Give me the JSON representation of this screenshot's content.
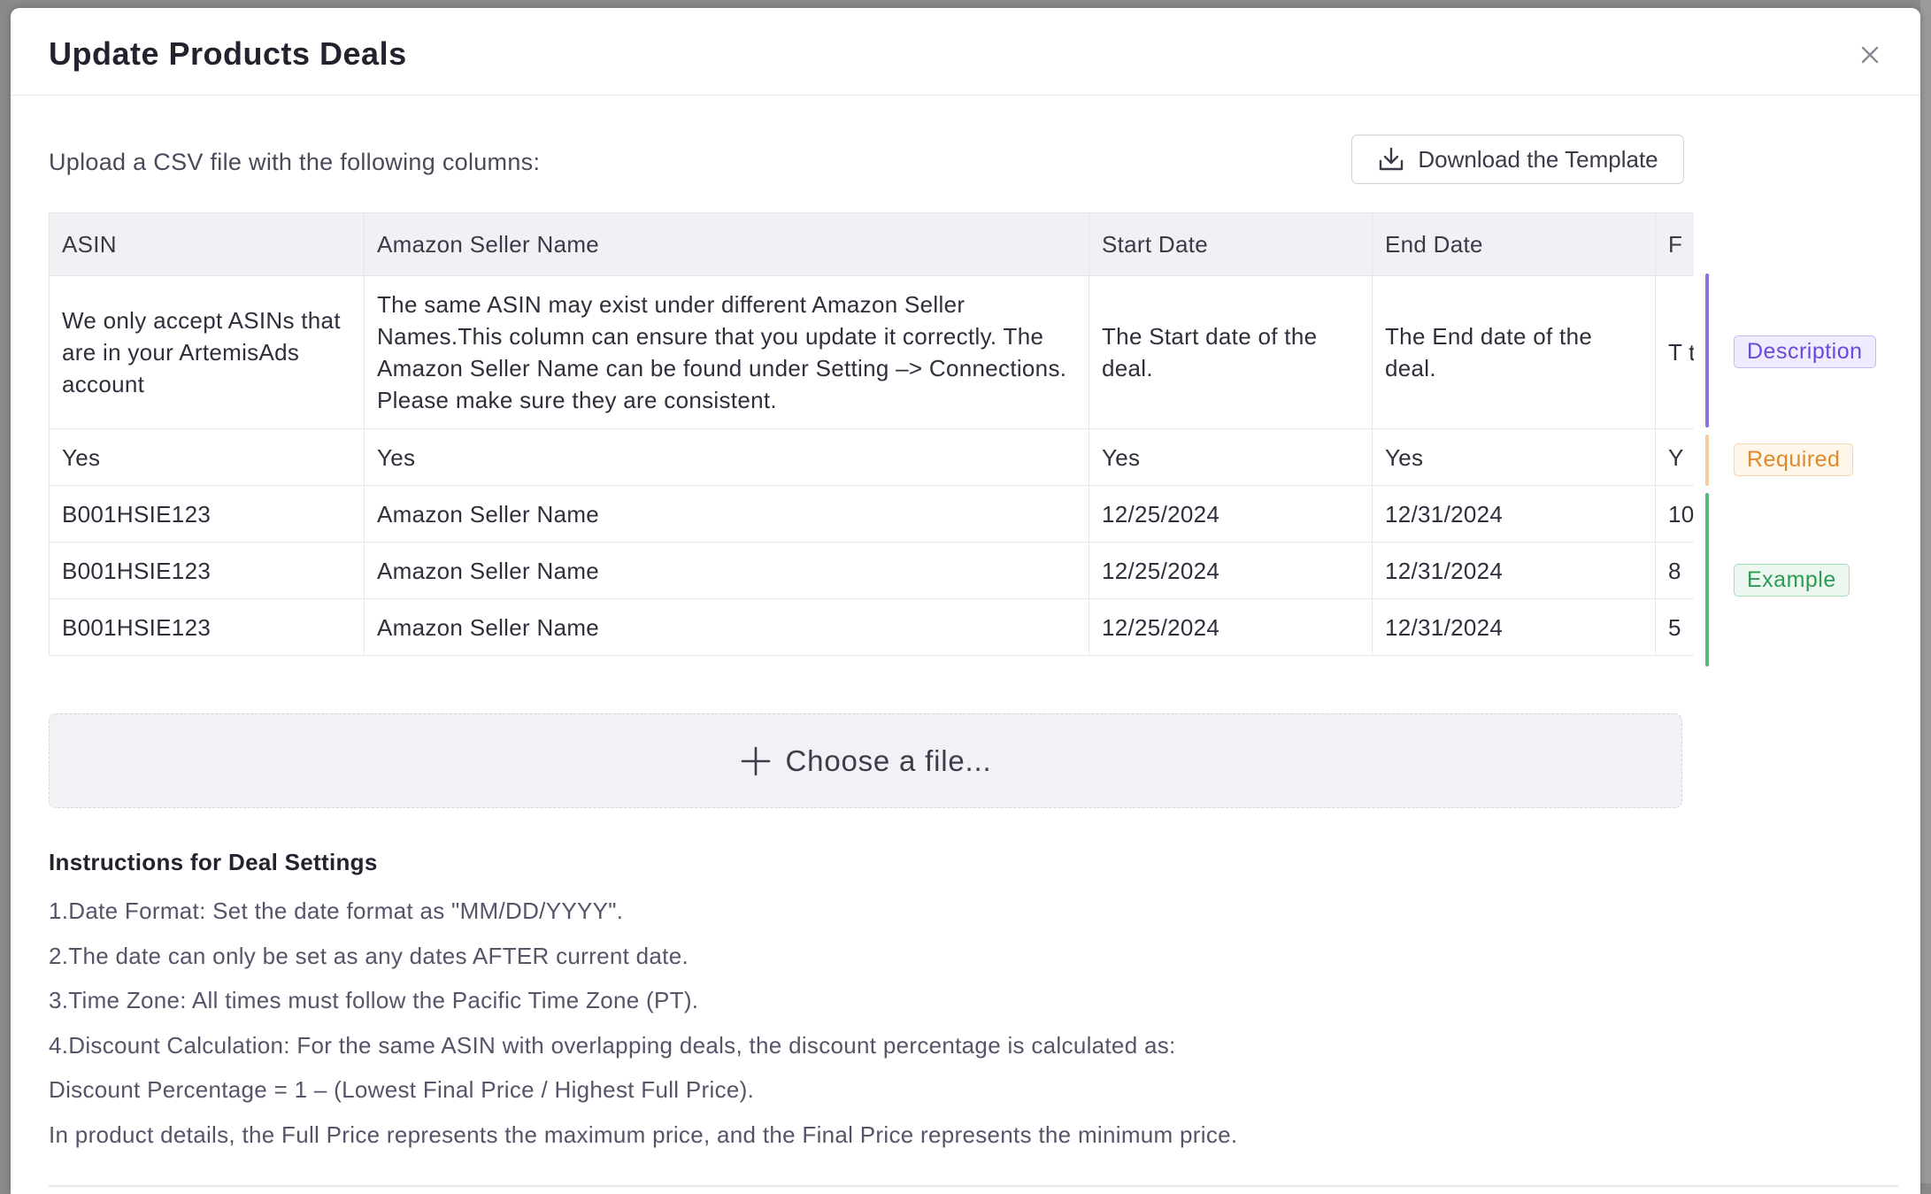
{
  "modal": {
    "title": "Update Products Deals",
    "intro": "Upload a CSV file with the following columns:",
    "download_label": "Download the Template"
  },
  "table": {
    "headers": [
      "ASIN",
      "Amazon Seller Name",
      "Start Date",
      "End Date",
      "F"
    ],
    "description_row": [
      "We only accept ASINs that are in your ArtemisAds account",
      "The same ASIN may exist under different Amazon Seller Names.This column can ensure that you update it correctly. The Amazon Seller Name can be found under Setting –> Connections. Please make sure they are consistent.",
      "The Start date of the deal.",
      "The End date of the deal.",
      "T th d"
    ],
    "required_row": [
      "Yes",
      "Yes",
      "Yes",
      "Yes",
      "Y"
    ],
    "example_rows": [
      [
        "B001HSIE123",
        "Amazon Seller Name",
        "12/25/2024",
        "12/31/2024",
        "10"
      ],
      [
        "B001HSIE123",
        "Amazon Seller Name",
        "12/25/2024",
        "12/31/2024",
        "8"
      ],
      [
        "B001HSIE123",
        "Amazon Seller Name",
        "12/25/2024",
        "12/31/2024",
        "5"
      ]
    ]
  },
  "legend": {
    "description": "Description",
    "required": "Required",
    "example": "Example",
    "colors": {
      "description": "#8f6fe0",
      "required": "#f4cf9a",
      "example": "#5bb47a"
    }
  },
  "upload": {
    "label": "Choose a file..."
  },
  "instructions": {
    "title": "Instructions for Deal Settings",
    "lines": [
      "1.Date Format: Set the date format as \"MM/DD/YYYY\".",
      "2.The date can only be set as any dates AFTER current date.",
      "3.Time Zone: All times must follow the Pacific Time Zone (PT).",
      "4.Discount Calculation: For the same ASIN with overlapping deals, the discount percentage is calculated as:",
      "Discount Percentage = 1 – (Lowest Final Price / Highest Full Price).",
      "In product details, the Full Price represents the maximum price, and the Final Price represents the minimum price."
    ]
  },
  "icons": {
    "close": "close-icon",
    "download": "download-icon",
    "add": "plus-icon"
  }
}
